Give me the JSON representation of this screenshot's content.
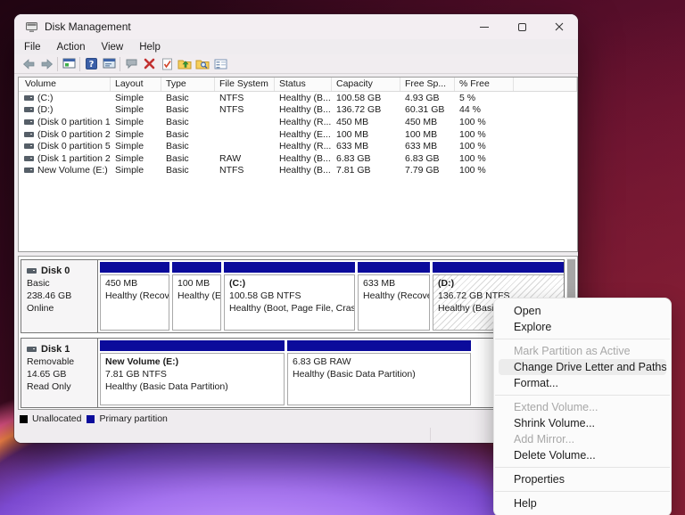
{
  "window": {
    "title": "Disk Management",
    "menu_bar": {
      "file": "File",
      "action": "Action",
      "view": "View",
      "help": "Help"
    },
    "toolbar_icons": [
      "back",
      "forward",
      "console-window",
      "help",
      "properties-window",
      "callout",
      "delete",
      "check-document",
      "folder-up",
      "folder-search",
      "details-view"
    ]
  },
  "colors": {
    "primary_partition": "#0b0b9b",
    "unallocated": "#000000",
    "menu_highlight": "#ececec",
    "delete_icon_red": "#c23030"
  },
  "volume_table": {
    "columns": [
      "Volume",
      "Layout",
      "Type",
      "File System",
      "Status",
      "Capacity",
      "Free Sp...",
      "% Free"
    ],
    "rows": [
      {
        "volume": "(C:)",
        "layout": "Simple",
        "type": "Basic",
        "fs": "NTFS",
        "status": "Healthy (B...",
        "capacity": "100.58 GB",
        "free": "4.93 GB",
        "pct": "5 %"
      },
      {
        "volume": "(D:)",
        "layout": "Simple",
        "type": "Basic",
        "fs": "NTFS",
        "status": "Healthy (B...",
        "capacity": "136.72 GB",
        "free": "60.31 GB",
        "pct": "44 %"
      },
      {
        "volume": "(Disk 0 partition 1)",
        "layout": "Simple",
        "type": "Basic",
        "fs": "",
        "status": "Healthy (R...",
        "capacity": "450 MB",
        "free": "450 MB",
        "pct": "100 %"
      },
      {
        "volume": "(Disk 0 partition 2)",
        "layout": "Simple",
        "type": "Basic",
        "fs": "",
        "status": "Healthy (E...",
        "capacity": "100 MB",
        "free": "100 MB",
        "pct": "100 %"
      },
      {
        "volume": "(Disk 0 partition 5)",
        "layout": "Simple",
        "type": "Basic",
        "fs": "",
        "status": "Healthy (R...",
        "capacity": "633 MB",
        "free": "633 MB",
        "pct": "100 %"
      },
      {
        "volume": "(Disk 1 partition 2)",
        "layout": "Simple",
        "type": "Basic",
        "fs": "RAW",
        "status": "Healthy (B...",
        "capacity": "6.83 GB",
        "free": "6.83 GB",
        "pct": "100 %"
      },
      {
        "volume": "New Volume (E:)",
        "layout": "Simple",
        "type": "Basic",
        "fs": "NTFS",
        "status": "Healthy (B...",
        "capacity": "7.81 GB",
        "free": "7.79 GB",
        "pct": "100 %"
      }
    ]
  },
  "disks": [
    {
      "name": "Disk 0",
      "kind": "Basic",
      "size": "238.46 GB",
      "state": "Online",
      "partitions": [
        {
          "name": "",
          "size_line": "450 MB",
          "status_line": "Healthy (Recov"
        },
        {
          "name": "",
          "size_line": "100 MB",
          "status_line": "Healthy (EF"
        },
        {
          "name": "(C:)",
          "size_line": "100.58 GB NTFS",
          "status_line": "Healthy (Boot, Page File, Crash I"
        },
        {
          "name": "",
          "size_line": "633 MB",
          "status_line": "Healthy (Recove"
        },
        {
          "name": "(D:)",
          "size_line": "136.72 GB NTFS",
          "status_line": "Healthy (Basic"
        }
      ]
    },
    {
      "name": "Disk 1",
      "kind": "Removable",
      "size": "14.65 GB",
      "state": "Read Only",
      "partitions": [
        {
          "name": "New Volume  (E:)",
          "size_line": "7.81 GB NTFS",
          "status_line": "Healthy (Basic Data Partition)"
        },
        {
          "name": "",
          "size_line": "6.83 GB RAW",
          "status_line": "Healthy (Basic Data Partition)"
        }
      ]
    }
  ],
  "legend": {
    "unallocated": "Unallocated",
    "primary": "Primary partition"
  },
  "context_menu": {
    "items": [
      {
        "label": "Open",
        "state": "enabled"
      },
      {
        "label": "Explore",
        "state": "enabled"
      },
      {
        "label": "Mark Partition as Active",
        "state": "disabled"
      },
      {
        "label": "Change Drive Letter and Paths...",
        "state": "highlighted"
      },
      {
        "label": "Format...",
        "state": "enabled"
      },
      {
        "label": "Extend Volume...",
        "state": "disabled"
      },
      {
        "label": "Shrink Volume...",
        "state": "enabled"
      },
      {
        "label": "Add Mirror...",
        "state": "disabled"
      },
      {
        "label": "Delete Volume...",
        "state": "enabled"
      },
      {
        "label": "Properties",
        "state": "enabled"
      },
      {
        "label": "Help",
        "state": "enabled"
      }
    ]
  }
}
